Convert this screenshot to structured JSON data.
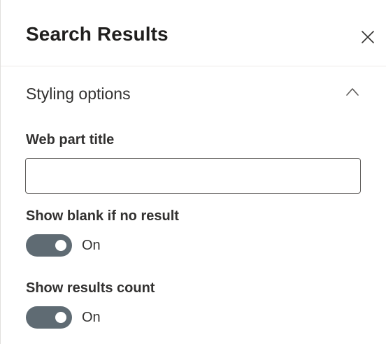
{
  "panel": {
    "title": "Search Results",
    "close_icon": "close-icon"
  },
  "section": {
    "title": "Styling options",
    "expanded": true,
    "chevron_icon": "chevron-up-icon"
  },
  "web_part_title": {
    "label": "Web part title",
    "value": "",
    "placeholder": ""
  },
  "show_blank": {
    "label": "Show blank if no result",
    "checked": true,
    "state_text": "On"
  },
  "show_count": {
    "label": "Show results count",
    "checked": true,
    "state_text": "On"
  },
  "colors": {
    "toggle_on": "#5f6b73",
    "text": "#323130",
    "border": "#605e5c"
  }
}
